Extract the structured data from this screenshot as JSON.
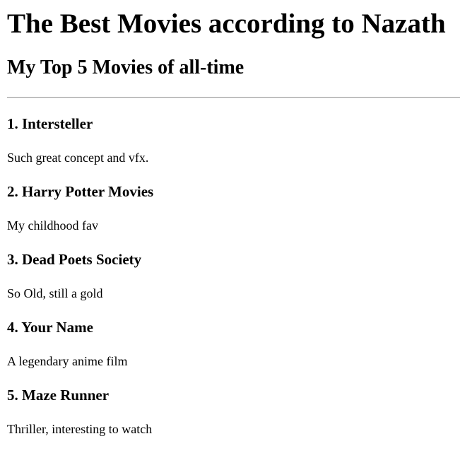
{
  "page": {
    "title": "The Best Movies according to Nazath",
    "subtitle": "My Top 5 Movies of all-time"
  },
  "movies": [
    {
      "title": "1. Intersteller",
      "description": "Such great concept and vfx."
    },
    {
      "title": "2. Harry Potter Movies",
      "description": "My childhood fav"
    },
    {
      "title": "3. Dead Poets Society",
      "description": "So Old, still a gold"
    },
    {
      "title": "4. Your Name",
      "description": "A legendary anime film"
    },
    {
      "title": "5. Maze Runner",
      "description": "Thriller, interesting to watch"
    }
  ]
}
